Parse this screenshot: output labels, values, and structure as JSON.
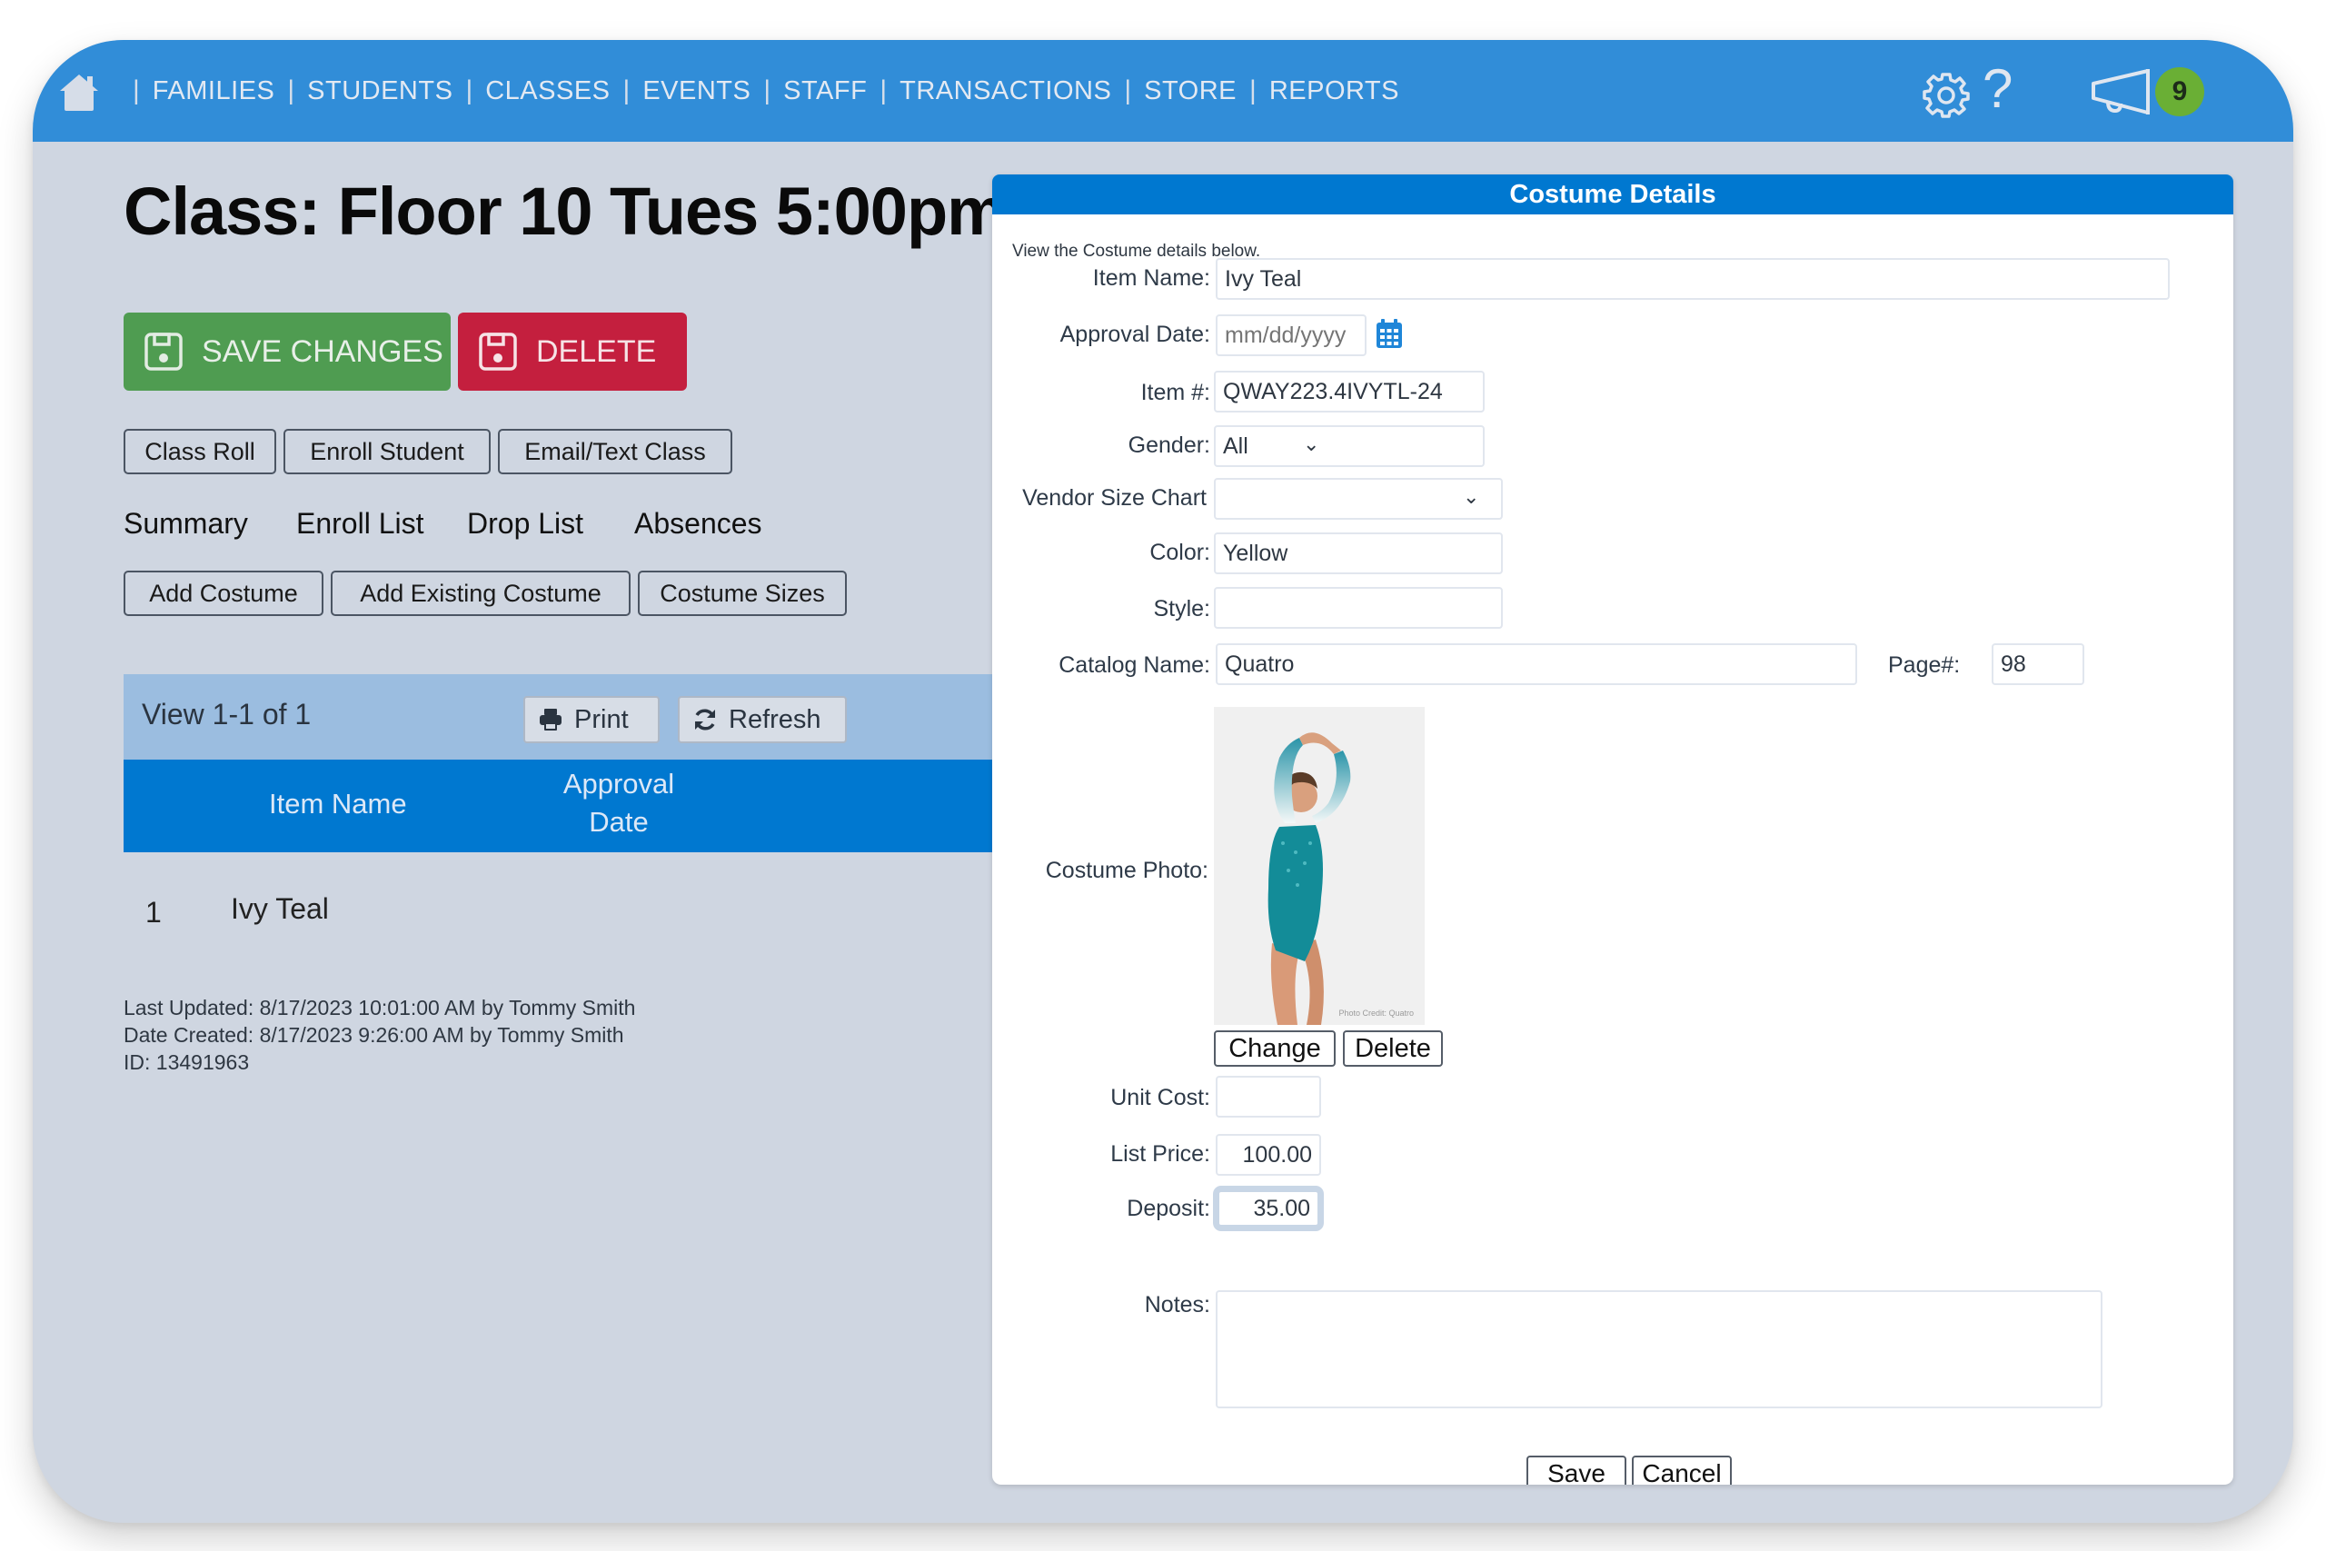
{
  "nav": {
    "items": [
      "FAMILIES",
      "STUDENTS",
      "CLASSES",
      "EVENTS",
      "STAFF",
      "TRANSACTIONS",
      "STORE",
      "REPORTS"
    ],
    "notification_count": "9",
    "help_glyph": "?"
  },
  "colors": {
    "nav_bg": "#318dd8",
    "save_green": "#4f9c51",
    "delete_red": "#c41f3e",
    "header_blue": "#0078d0",
    "badge_green": "#6aaf35"
  },
  "page": {
    "title": "Class: Floor 10 Tues 5:00pm",
    "save_label": "SAVE CHANGES",
    "delete_label": "DELETE",
    "actions": [
      "Class Roll",
      "Enroll Student",
      "Email/Text Class"
    ],
    "tabs": [
      "Summary",
      "Enroll List",
      "Drop List",
      "Absences"
    ],
    "costume_actions": [
      "Add Costume",
      "Add Existing Costume",
      "Costume Sizes"
    ]
  },
  "grid": {
    "view_count": "View 1-1 of 1",
    "print_label": "Print",
    "refresh_label": "Refresh",
    "columns": [
      "Item Name",
      "Approval",
      "Date"
    ],
    "rows": [
      {
        "num": "1",
        "item_name": "Ivy Teal",
        "approval_date": ""
      }
    ]
  },
  "meta": {
    "last_updated": "Last Updated: 8/17/2023 10:01:00 AM by Tommy Smith",
    "date_created": "Date Created: 8/17/2023 9:26:00 AM by Tommy Smith",
    "id": "ID: 13491963"
  },
  "modal": {
    "title": "Costume Details",
    "intro": "View the Costume details below.",
    "labels": {
      "item_name": "Item Name:",
      "approval_date": "Approval Date:",
      "item_num": "Item #:",
      "gender": "Gender:",
      "vendor_size_chart": "Vendor Size Chart",
      "color": "Color:",
      "style": "Style:",
      "catalog_name": "Catalog Name:",
      "page_num": "Page#:",
      "costume_photo": "Costume Photo:",
      "unit_cost": "Unit Cost:",
      "list_price": "List Price:",
      "deposit": "Deposit:",
      "notes": "Notes:"
    },
    "values": {
      "item_name": "Ivy Teal",
      "approval_date_placeholder": "mm/dd/yyyy",
      "item_num": "QWAY223.4IVYTL-24",
      "gender": "All",
      "vendor_size_chart": "",
      "color": "Yellow",
      "style": "",
      "catalog_name": "Quatro",
      "page_num": "98",
      "unit_cost": "",
      "list_price": "100.00",
      "deposit": "35.00",
      "notes": ""
    },
    "photo_credit": "Photo Credit: Quatro",
    "change_label": "Change",
    "photo_delete_label": "Delete",
    "save_label": "Save",
    "cancel_label": "Cancel"
  }
}
